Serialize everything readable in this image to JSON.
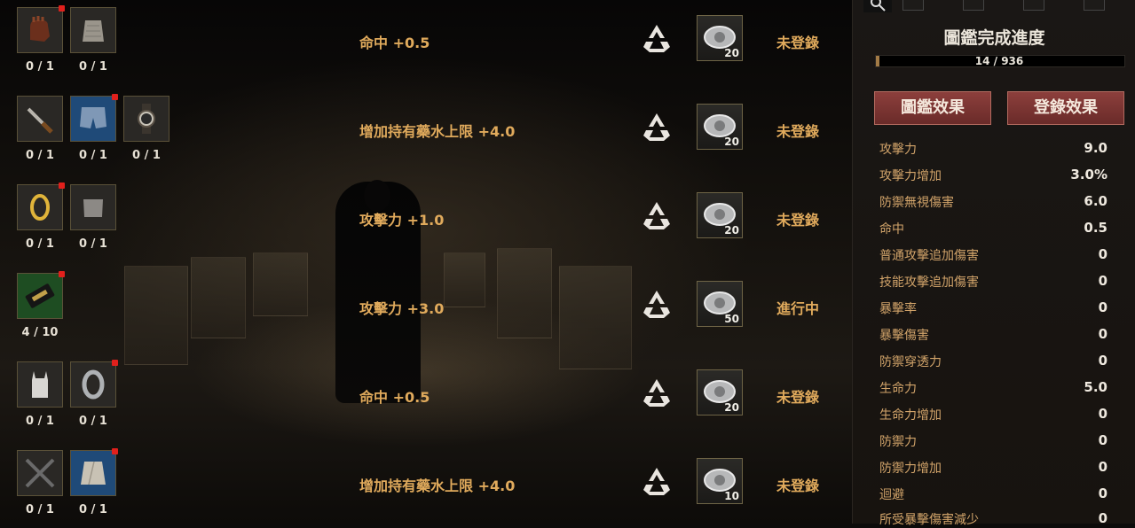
{
  "items": [
    [
      {
        "icon": "gloves-icon",
        "count": "0 / 1",
        "new": true
      },
      {
        "icon": "skirt-icon",
        "count": "0 / 1",
        "new": false
      }
    ],
    [
      {
        "icon": "knife-icon",
        "count": "0 / 1",
        "new": false
      },
      {
        "icon": "jeans-shorts-icon",
        "count": "0 / 1",
        "new": true
      },
      {
        "icon": "watch-icon",
        "count": "0 / 1",
        "new": false
      }
    ],
    [
      {
        "icon": "gold-ring-icon",
        "count": "0 / 1",
        "new": true
      },
      {
        "icon": "tube-top-icon",
        "count": "0 / 1",
        "new": false
      }
    ],
    [
      {
        "icon": "casino-card-icon",
        "count": "4 / 10",
        "new": true
      }
    ],
    [
      {
        "icon": "tank-top-icon",
        "count": "0 / 1",
        "new": false
      },
      {
        "icon": "silver-ring-icon",
        "count": "0 / 1",
        "new": true
      }
    ],
    [
      {
        "icon": "crossed-blades-icon",
        "count": "0 / 1",
        "new": false
      },
      {
        "icon": "wrap-skirt-icon",
        "count": "0 / 1",
        "new": true
      }
    ]
  ],
  "effects": [
    {
      "text": "命中 +0.5",
      "coin": "20",
      "status": "未登錄"
    },
    {
      "text": "增加持有藥水上限 +4.0",
      "coin": "20",
      "status": "未登錄"
    },
    {
      "text": "攻擊力 +1.0",
      "coin": "20",
      "status": "未登錄"
    },
    {
      "text": "攻擊力 +3.0",
      "coin": "50",
      "status": "進行中"
    },
    {
      "text": "命中 +0.5",
      "coin": "20",
      "status": "未登錄"
    },
    {
      "text": "增加持有藥水上限 +4.0",
      "coin": "10",
      "status": "未登錄"
    }
  ],
  "panel": {
    "title": "圖鑑完成進度",
    "progress_text": "14 / 936",
    "progress_fraction": 0.015,
    "tab_effect": "圖鑑效果",
    "tab_register": "登錄效果",
    "stats": [
      {
        "label": "攻擊力",
        "value": "9.0"
      },
      {
        "label": "攻擊力增加",
        "value": "3.0%"
      },
      {
        "label": "防禦無視傷害",
        "value": "6.0"
      },
      {
        "label": "命中",
        "value": "0.5"
      },
      {
        "label": "普通攻擊追加傷害",
        "value": "0"
      },
      {
        "label": "技能攻擊追加傷害",
        "value": "0"
      },
      {
        "label": "暴擊率",
        "value": "0"
      },
      {
        "label": "暴擊傷害",
        "value": "0"
      },
      {
        "label": "防禦穿透力",
        "value": "0"
      },
      {
        "label": "生命力",
        "value": "5.0"
      },
      {
        "label": "生命力增加",
        "value": "0"
      },
      {
        "label": "防禦力",
        "value": "0"
      },
      {
        "label": "防禦力增加",
        "value": "0"
      },
      {
        "label": "迴避",
        "value": "0"
      },
      {
        "label": "所受暴擊傷害減少",
        "value": "0"
      }
    ]
  },
  "colors": {
    "accent": "#e0aa5c",
    "new_dot": "#e0201c",
    "tab": "#8c3f3c"
  }
}
